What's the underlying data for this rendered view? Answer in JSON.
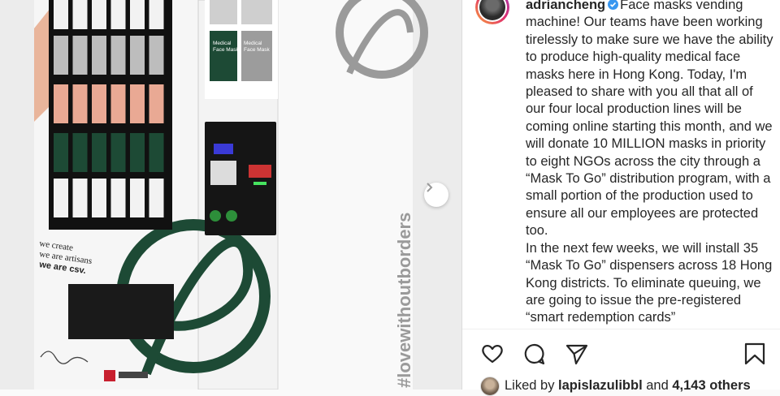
{
  "post": {
    "username": "adriancheng",
    "caption": "Face masks vending machine! Our teams have been working tirelessly to make sure we have the ability to produce high-quality medical face masks here in Hong Kong. Today, I'm pleased to share with you all that all of our four local production lines will be coming online starting this month, and we will donate 10 MILLION masks in priority to eight NGOs across the city through a “Mask To Go” distribution program, with a small portion of the production used to ensure all our employees are protected too.\nIn the next few weeks, we will install 35 “Mask To Go” dispensers across 18 Hong Kong districts. To eliminate queuing, we are going to issue the pre-registered “smart redemption cards”",
    "liked_by_prefix": "Liked by ",
    "liked_by_user": "lapislazulibbl",
    "liked_by_mid": " and ",
    "liked_by_count": "4,143 others"
  },
  "image": {
    "machine_slogan_1": "we create",
    "machine_slogan_2": "we are artisans",
    "machine_slogan_3": "we are csv.",
    "side_hashtag": "#lovewithoutborders",
    "mask_label_1": "Medical",
    "mask_label_2": "Face Mask"
  },
  "icons": {
    "verified": "verified-badge-icon",
    "like": "heart-icon",
    "comment": "comment-bubble-icon",
    "share": "paper-plane-icon",
    "save": "bookmark-icon",
    "next": "chevron-right-icon"
  },
  "colors": {
    "brand_green": "#1d4a35",
    "verified_blue": "#3897f0",
    "text": "#262626"
  }
}
